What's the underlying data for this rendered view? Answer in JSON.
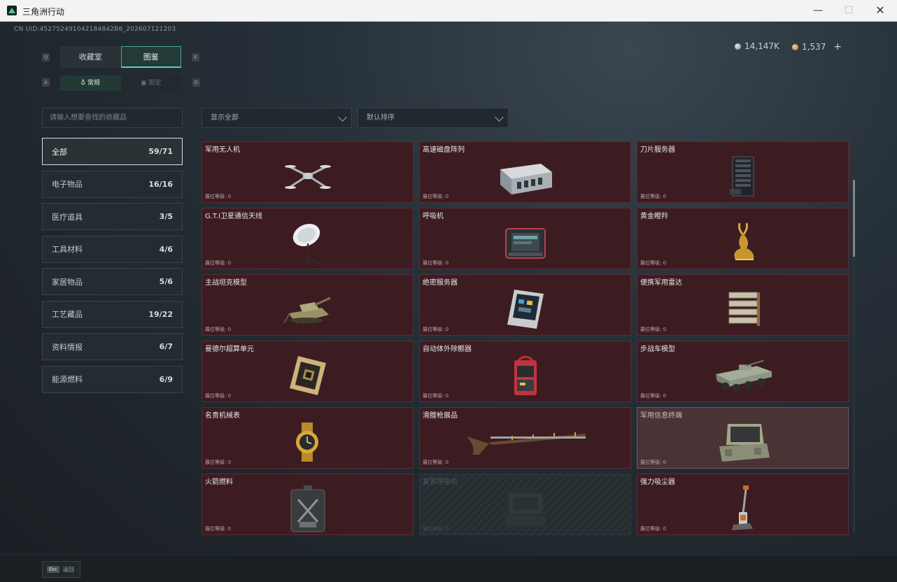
{
  "window": {
    "title": "三角洲行动",
    "minimize": "—",
    "maximize": "☐",
    "close": "✕"
  },
  "header": {
    "uid": "CN UID:452752491042184842B6_202607121203",
    "currency_silver": "14,147K",
    "currency_gold": "1,537",
    "plus": "+"
  },
  "keyhints": {
    "q": "Q",
    "e": "E",
    "a": "A",
    "d": "D"
  },
  "tabs": [
    {
      "label": "收藏室"
    },
    {
      "label": "图鉴"
    }
  ],
  "subtabs": [
    {
      "label": "常规"
    },
    {
      "label": "限定"
    }
  ],
  "search": {
    "placeholder": "请输入想要查找的收藏品"
  },
  "filters": {
    "show": "显示全部",
    "sort": "默认排序"
  },
  "categories": [
    {
      "label": "全部",
      "count": "59/71"
    },
    {
      "label": "电子物品",
      "count": "16/16"
    },
    {
      "label": "医疗道具",
      "count": "3/5"
    },
    {
      "label": "工具材料",
      "count": "4/6"
    },
    {
      "label": "家居物品",
      "count": "5/6"
    },
    {
      "label": "工艺藏品",
      "count": "19/22"
    },
    {
      "label": "资料情报",
      "count": "6/7"
    },
    {
      "label": "能源燃料",
      "count": "6/9"
    }
  ],
  "items": [
    {
      "name": "军用无人机",
      "level": "展位等级: 0",
      "icon": "drone-icon"
    },
    {
      "name": "高速磁盘阵列",
      "level": "展位等级: 0",
      "icon": "disk-array-icon"
    },
    {
      "name": "刀片服务器",
      "level": "展位等级: 0",
      "icon": "blade-server-icon"
    },
    {
      "name": "G.T.I卫星通信天线",
      "level": "展位等级: 0",
      "icon": "satellite-dish-icon"
    },
    {
      "name": "呼吸机",
      "level": "展位等级: 0",
      "icon": "ventilator-icon"
    },
    {
      "name": "黄金瞪羚",
      "level": "展位等级: 0",
      "icon": "golden-gazelle-icon"
    },
    {
      "name": "主战坦克模型",
      "level": "展位等级: 0",
      "icon": "tank-model-icon"
    },
    {
      "name": "绝密服务器",
      "level": "展位等级: 0",
      "icon": "secret-server-icon"
    },
    {
      "name": "便携军用雷达",
      "level": "展位等级: 0",
      "icon": "radar-icon"
    },
    {
      "name": "曼德尔超算单元",
      "level": "展位等级: 0",
      "icon": "supercomputer-icon"
    },
    {
      "name": "自动体外除颤器",
      "level": "展位等级: 0",
      "icon": "defibrillator-icon"
    },
    {
      "name": "步战车模型",
      "level": "展位等级: 0",
      "icon": "ifv-model-icon"
    },
    {
      "name": "名贵机械表",
      "level": "展位等级: 0",
      "icon": "watch-icon"
    },
    {
      "name": "滑膛枪展品",
      "level": "展位等级: 0",
      "icon": "musket-icon"
    },
    {
      "name": "军用信息终端",
      "level": "展位等级: 0",
      "icon": "terminal-icon"
    },
    {
      "name": "火箭燃料",
      "level": "展位等级: 0",
      "icon": "rocket-fuel-icon"
    },
    {
      "name": "复苏呼吸机",
      "level": "展位等级: 0",
      "icon": "resus-ventilator-icon"
    },
    {
      "name": "强力吸尘器",
      "level": "展位等级: 0",
      "icon": "vacuum-icon"
    }
  ],
  "footer": {
    "esc_key": "Esc",
    "esc_label": "返回"
  }
}
